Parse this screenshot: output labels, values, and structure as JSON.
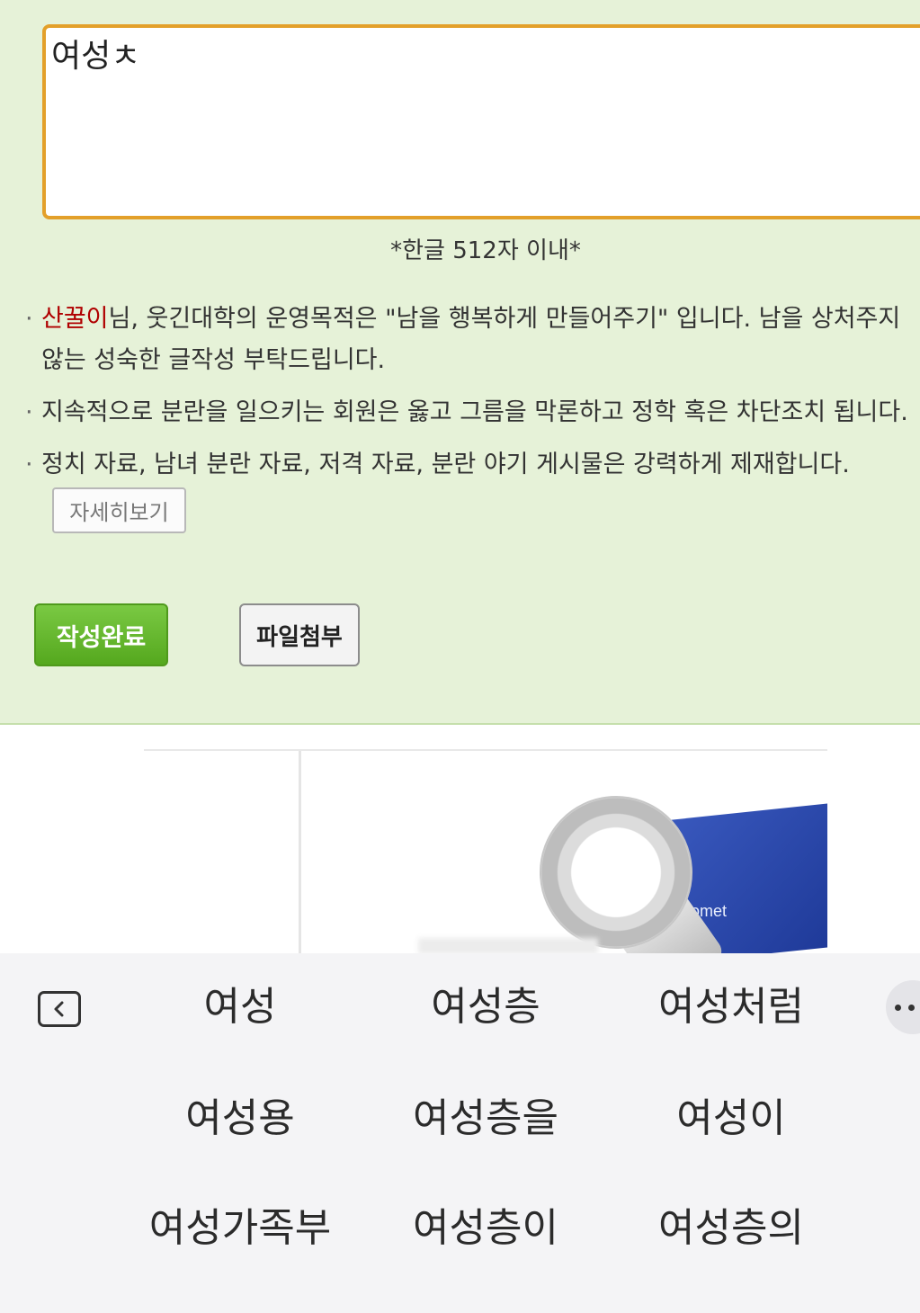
{
  "editor": {
    "value": "여성ㅊ"
  },
  "char_limit": "*한글 512자 이내*",
  "notices": {
    "n1_username": "산꿀이",
    "n1_text_a": "님, 웃긴대학의 운영목적은 \"남을 행복하게 만들어주기\" 입니다. 남을 상처주지",
    "n1_text_b": "않는 성숙한 글작성 부탁드립니다.",
    "n2_text": "지속적으로 분란을 일으키는 회원은 옳고 그름을 막론하고 정학 혹은 차단조치 됩니다.",
    "n3_text": "정치 자료, 남녀 분란 자료, 저격 자료, 분란 야기 게시물은 강력하게 제재합니다."
  },
  "buttons": {
    "detail": "자세히보기",
    "submit": "작성완료",
    "attach": "파일첨부"
  },
  "ad": {
    "brand": "omet"
  },
  "keyboard": {
    "suggestions": [
      [
        "여성",
        "여성층",
        "여성처럼"
      ],
      [
        "여성용",
        "여성층을",
        "여성이"
      ],
      [
        "여성가족부",
        "여성층이",
        "여성층의"
      ]
    ]
  },
  "colors": {
    "panel_bg": "#e6f2d8",
    "editor_border": "#e3a02a",
    "submit_green": "#5bb024",
    "username_red": "#b00000"
  }
}
